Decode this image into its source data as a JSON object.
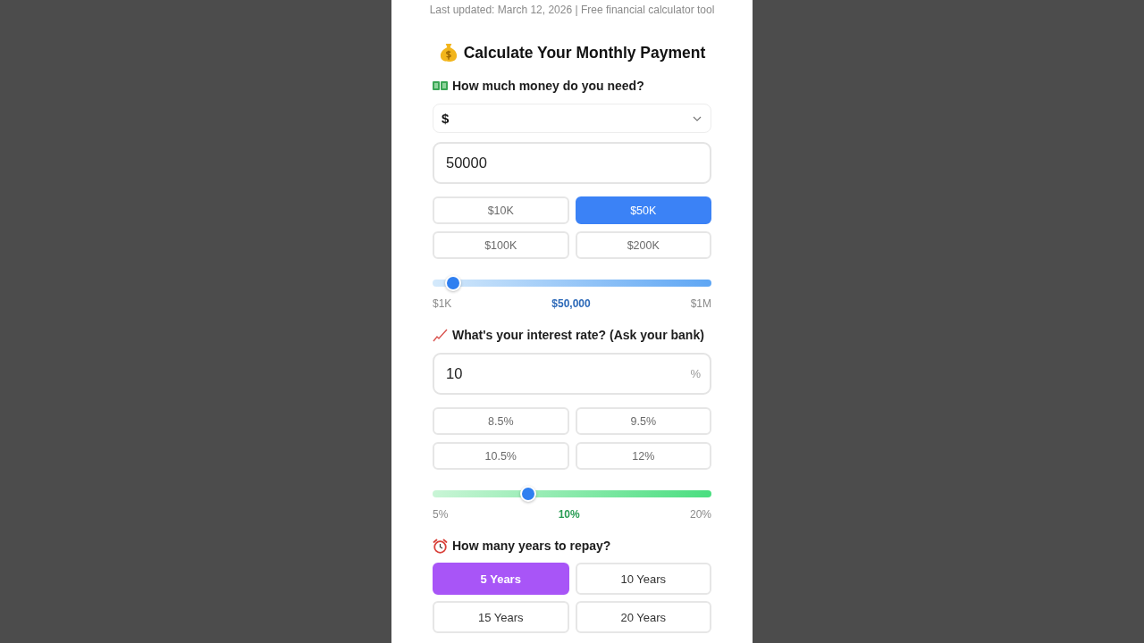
{
  "header": {
    "updated": "Last updated: March 12, 2026 | Free financial calculator tool"
  },
  "title": "Calculate Your Monthly Payment",
  "sections": [
    {
      "kind": "amount",
      "label": "How much money do you need?",
      "currency": {
        "value": "$"
      },
      "input": {
        "value": "50000"
      },
      "presets": [
        {
          "label": "$10K",
          "selected": false
        },
        {
          "label": "$50K",
          "selected": true
        },
        {
          "label": "$100K",
          "selected": false
        },
        {
          "label": "$200K",
          "selected": false
        }
      ],
      "slider": {
        "level": 0.049,
        "min": "$1K",
        "value": "$50,000",
        "max": "$1M"
      }
    },
    {
      "kind": "rate",
      "label": "What's your interest rate? (Ask your bank)",
      "input": {
        "value": "10",
        "unit": "%"
      },
      "presets": [
        {
          "label": "8.5%",
          "selected": false
        },
        {
          "label": "9.5%",
          "selected": false
        },
        {
          "label": "10.5%",
          "selected": false
        },
        {
          "label": "12%",
          "selected": false
        }
      ],
      "slider": {
        "level": 0.333,
        "min": "5%",
        "value": "10%",
        "max": "20%"
      }
    },
    {
      "kind": "term",
      "label": "How many years to repay?",
      "options": [
        {
          "label": "5 Years",
          "selected": true
        },
        {
          "label": "10 Years",
          "selected": false
        },
        {
          "label": "15 Years",
          "selected": false
        },
        {
          "label": "20 Years",
          "selected": false
        }
      ]
    }
  ]
}
